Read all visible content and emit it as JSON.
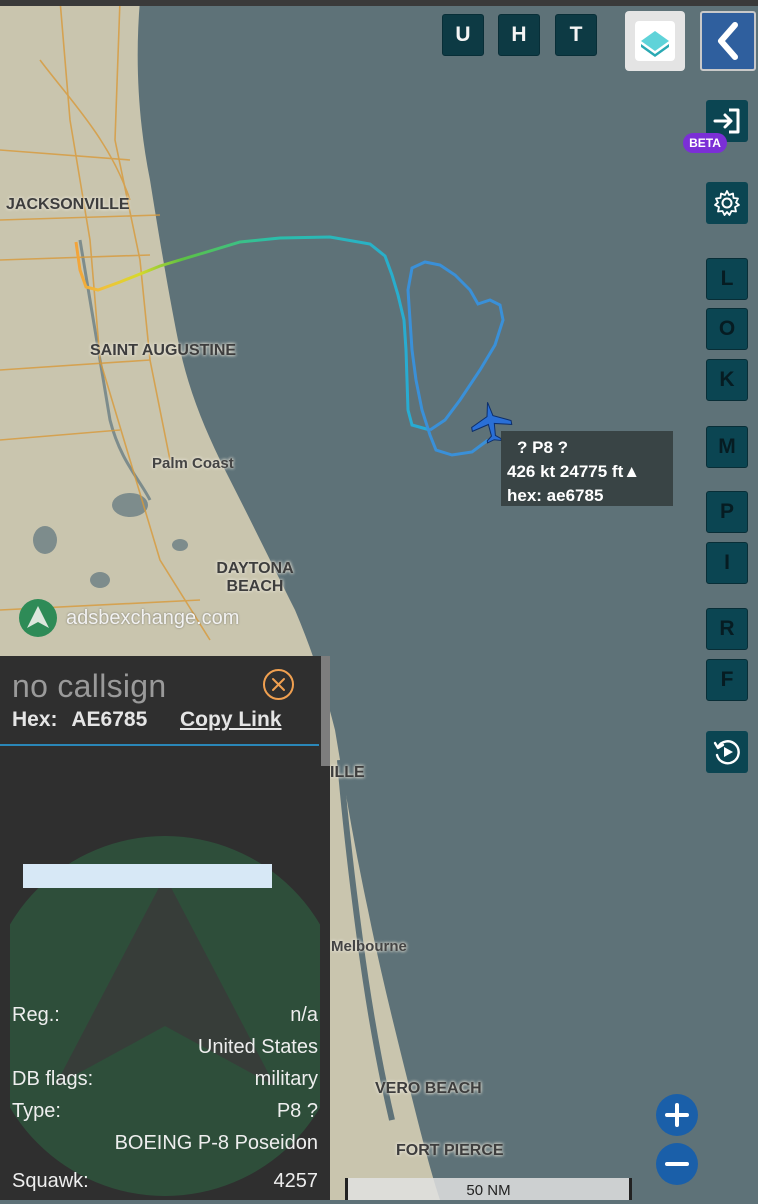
{
  "map": {
    "cities": [
      {
        "name": "JACKSONVILLE"
      },
      {
        "name": "SAINT AUGUSTINE"
      },
      {
        "name": "Palm Coast"
      },
      {
        "name": "DAYTONA BEACH"
      },
      {
        "name": "ILLE"
      },
      {
        "name": "Melbourne"
      },
      {
        "name": "VERO BEACH"
      },
      {
        "name": "FORT PIERCE"
      }
    ],
    "attribution": "adsbexchange.com",
    "scale_label": "50 NM",
    "water_color": "#5e7278",
    "land_color": "#c9c5ae",
    "aircraft_color": "#2a6fd6"
  },
  "top_buttons": {
    "u": "U",
    "h": "H",
    "t": "T"
  },
  "side_buttons": {
    "beta": "BETA",
    "l": "L",
    "o": "O",
    "k": "K",
    "m": "M",
    "p": "P",
    "i": "I",
    "r": "R",
    "f": "F"
  },
  "aircraft_label": {
    "line1": "?   P8 ?",
    "line2": "426 kt  24775 ft▲",
    "line3": "hex: ae6785"
  },
  "info_panel": {
    "title": "no callsign",
    "hex_label": "Hex:",
    "hex_value": "AE6785",
    "copy_link": "Copy Link",
    "rows": [
      {
        "key": "Reg.:",
        "value": "n/a"
      },
      {
        "key": "",
        "value": "United States"
      },
      {
        "key": "DB flags:",
        "value": "military"
      },
      {
        "key": "Type:",
        "value": "P8 ?"
      },
      {
        "key": "",
        "value": "BOEING P-8 Poseidon"
      },
      {
        "key": "Squawk:",
        "value": "4257"
      }
    ]
  }
}
